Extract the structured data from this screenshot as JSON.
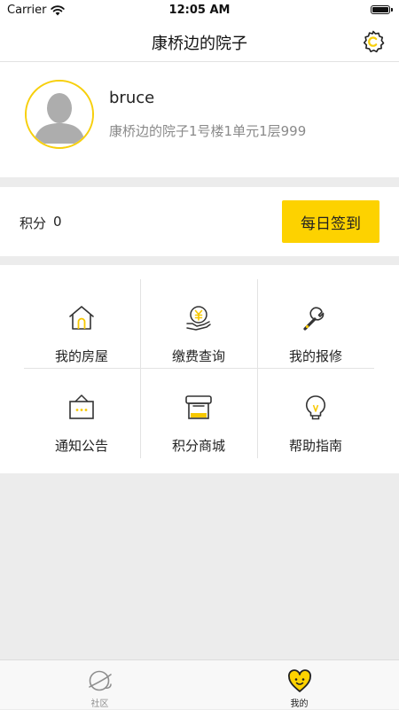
{
  "status_bar": {
    "carrier": "Carrier",
    "time": "12:05 AM"
  },
  "nav": {
    "title": "康桥边的院子"
  },
  "profile": {
    "username": "bruce",
    "address": "康桥边的院子1号楼1单元1层999"
  },
  "points": {
    "label": "积分",
    "value": "0",
    "signin_label": "每日签到"
  },
  "menu": {
    "items": [
      {
        "label": "我的房屋",
        "icon": "house-icon"
      },
      {
        "label": "缴费查询",
        "icon": "payment-icon"
      },
      {
        "label": "我的报修",
        "icon": "wrench-icon"
      },
      {
        "label": "通知公告",
        "icon": "notice-board-icon"
      },
      {
        "label": "积分商城",
        "icon": "shop-icon"
      },
      {
        "label": "帮助指南",
        "icon": "lightbulb-icon"
      }
    ]
  },
  "tabs": [
    {
      "label": "社区",
      "icon": "planet-icon",
      "active": false
    },
    {
      "label": "我的",
      "icon": "heart-icon",
      "active": true
    }
  ],
  "colors": {
    "accent": "#fdd200",
    "avatar_ring": "#f7cf0b",
    "background": "#ececec",
    "secondary_text": "#8a8a8a"
  }
}
